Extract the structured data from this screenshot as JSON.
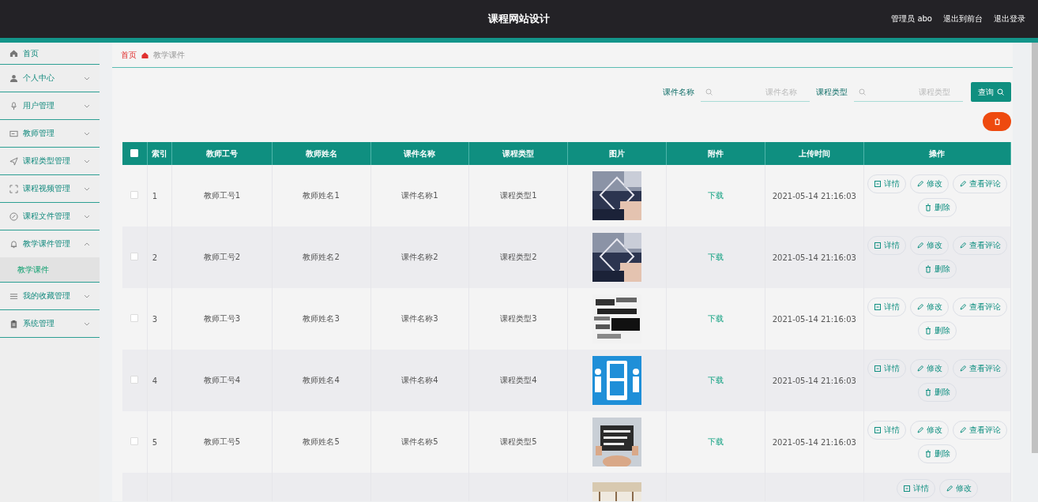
{
  "header": {
    "title": "课程网站设计",
    "user": "管理员 abo",
    "links": [
      "退出到前台",
      "退出登录"
    ]
  },
  "sidebar": {
    "items": [
      {
        "label": "首页",
        "kind": "link"
      },
      {
        "label": "个人中心",
        "kind": "menu",
        "expanded": false
      },
      {
        "label": "用户管理",
        "kind": "menu",
        "expanded": false
      },
      {
        "label": "教师管理",
        "kind": "menu",
        "expanded": false
      },
      {
        "label": "课程类型管理",
        "kind": "menu",
        "expanded": false
      },
      {
        "label": "课程视频管理",
        "kind": "menu",
        "expanded": false
      },
      {
        "label": "课程文件管理",
        "kind": "menu",
        "expanded": false
      },
      {
        "label": "教学课件管理",
        "kind": "menu",
        "expanded": true,
        "children": [
          {
            "label": "教学课件",
            "selected": true
          }
        ]
      },
      {
        "label": "我的收藏管理",
        "kind": "menu",
        "expanded": false
      },
      {
        "label": "系统管理",
        "kind": "menu",
        "expanded": false
      }
    ]
  },
  "breadcrumb": [
    "首页",
    "教学课件"
  ],
  "search": {
    "fields": [
      {
        "label": "课件名称",
        "placeholder": "课件名称"
      },
      {
        "label": "课程类型",
        "placeholder": "课程类型"
      }
    ],
    "button": "查询"
  },
  "table": {
    "select_all": false,
    "columns": [
      "索引",
      "教师工号",
      "教师姓名",
      "课件名称",
      "课程类型",
      "图片",
      "附件",
      "上传时间",
      "操作"
    ],
    "rows": [
      {
        "selected": false,
        "cells": [
          "1",
          "教师工号1",
          "教师姓名1",
          "课件名称1",
          "课程类型1"
        ],
        "attachment": "下载",
        "time": "2021-05-14 21:16:03",
        "actions": [
          "详情",
          "修改",
          "查看评论",
          "删除"
        ]
      },
      {
        "selected": false,
        "cells": [
          "2",
          "教师工号2",
          "教师姓名2",
          "课件名称2",
          "课程类型2"
        ],
        "attachment": "下载",
        "time": "2021-05-14 21:16:03",
        "actions": [
          "详情",
          "修改",
          "查看评论",
          "删除"
        ]
      },
      {
        "selected": false,
        "cells": [
          "3",
          "教师工号3",
          "教师姓名3",
          "课件名称3",
          "课程类型3"
        ],
        "attachment": "下载",
        "time": "2021-05-14 21:16:03",
        "actions": [
          "详情",
          "修改",
          "查看评论",
          "删除"
        ]
      },
      {
        "selected": false,
        "cells": [
          "4",
          "教师工号4",
          "教师姓名4",
          "课件名称4",
          "课程类型4"
        ],
        "attachment": "下载",
        "time": "2021-05-14 21:16:03",
        "actions": [
          "详情",
          "修改",
          "查看评论",
          "删除"
        ]
      },
      {
        "selected": false,
        "cells": [
          "5",
          "教师工号5",
          "教师姓名5",
          "课件名称5",
          "课程类型5"
        ],
        "attachment": "下载",
        "time": "2021-05-14 21:16:03",
        "actions": [
          "详情",
          "修改",
          "查看评论",
          "删除"
        ]
      },
      {
        "cells": [],
        "actions": [
          "详情",
          "修改"
        ]
      }
    ]
  }
}
